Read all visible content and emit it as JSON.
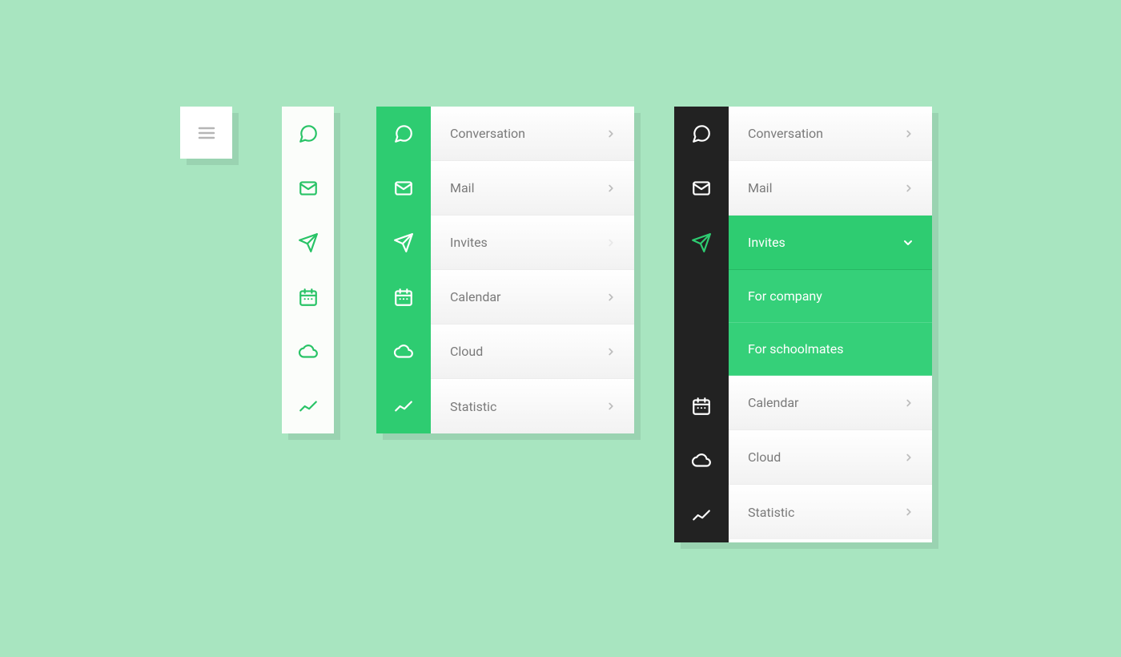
{
  "colors": {
    "background": "#a8e5c0",
    "green": "#2ecc71",
    "green_sub": "#35d079",
    "dark": "#222222",
    "text_muted": "#7a7a7a"
  },
  "nav_items": {
    "conversation": "Conversation",
    "mail": "Mail",
    "invites": "Invites",
    "calendar": "Calendar",
    "cloud": "Cloud",
    "statistic": "Statistic"
  },
  "invites_submenu": {
    "company": "For company",
    "schoolmates": "For schoolmates"
  },
  "icons": {
    "hamburger": "hamburger-icon",
    "conversation": "speech-bubble-icon",
    "mail": "envelope-icon",
    "invites": "paper-plane-icon",
    "calendar": "calendar-icon",
    "cloud": "cloud-icon",
    "statistic": "chart-line-icon"
  }
}
